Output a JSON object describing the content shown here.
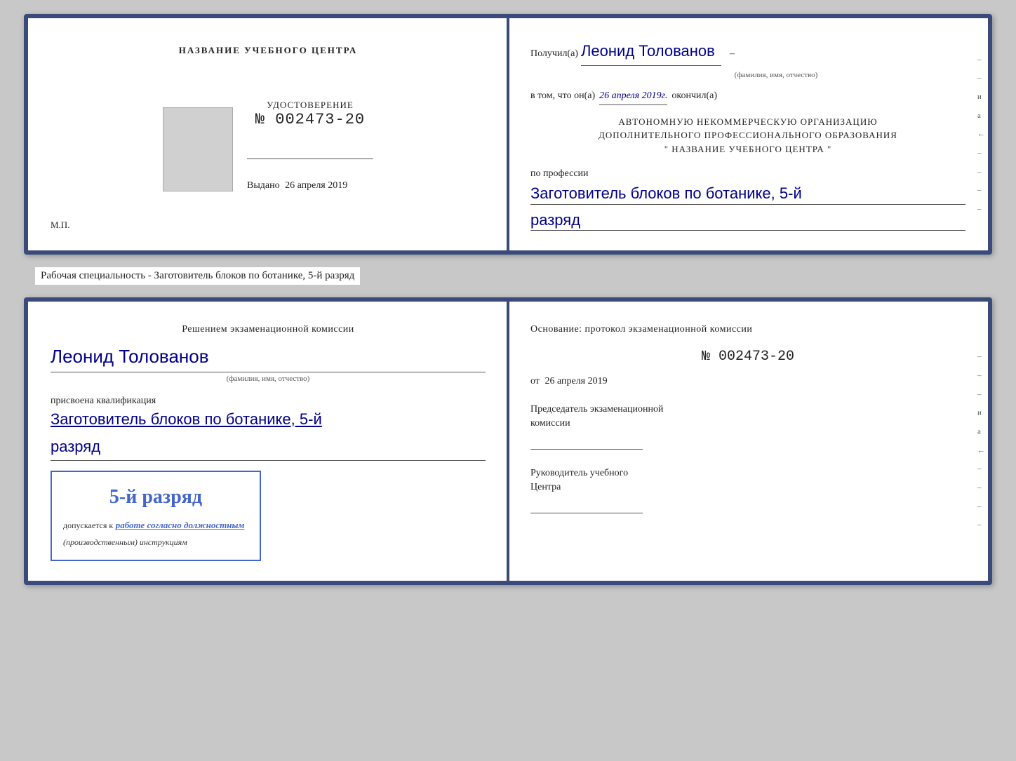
{
  "top_doc": {
    "left": {
      "title": "НАЗВАНИЕ УЧЕБНОГО ЦЕНТРА",
      "cert_label": "УДОСТОВЕРЕНИЕ",
      "cert_number": "№ 002473-20",
      "issued_label": "Выдано",
      "issued_date": "26 апреля 2019",
      "mp_label": "М.П."
    },
    "right": {
      "received_prefix": "Получил(а)",
      "received_name": "Леонид Толованов",
      "fio_label": "(фамилия, имя, отчество)",
      "dash": "–",
      "vtom_prefix": "в том, что он(а)",
      "vtom_date": "26 апреля 2019г.",
      "vtom_suffix": "окончил(а)",
      "org_line1": "АВТОНОМНУЮ НЕКОММЕРЧЕСКУЮ ОРГАНИЗАЦИЮ",
      "org_line2": "ДОПОЛНИТЕЛЬНОГО ПРОФЕССИОНАЛЬНОГО ОБРАЗОВАНИЯ",
      "org_line3": "\" НАЗВАНИЕ УЧЕБНОГО ЦЕНТРА \"",
      "profession_prefix": "по профессии",
      "profession_value": "Заготовитель блоков по ботанике, 5-й",
      "razryad_value": "разряд"
    }
  },
  "specialty_label": "Рабочая специальность - Заготовитель блоков по ботанике, 5-й разряд",
  "bottom_doc": {
    "left": {
      "decision_line": "Решением экзаменационной комиссии",
      "person_name": "Леонид Толованов",
      "fio_label": "(фамилия, имя, отчество)",
      "assigned_text": "присвоена квалификация",
      "qualification": "Заготовитель блоков по ботанике, 5-й",
      "razryad": "разряд",
      "stamp_rank": "5-й разряд",
      "stamp_prefix": "допускается к",
      "stamp_link": "работе согласно должностным",
      "stamp_suffix": "(производственным) инструкциям"
    },
    "right": {
      "osnov_text": "Основание: протокол экзаменационной комиссии",
      "protocol_number": "№ 002473-20",
      "from_prefix": "от",
      "from_date": "26 апреля 2019",
      "chairman_label": "Председатель экзаменационной",
      "chairman_label2": "комиссии",
      "head_label": "Руководитель учебного",
      "head_label2": "Центра"
    }
  }
}
